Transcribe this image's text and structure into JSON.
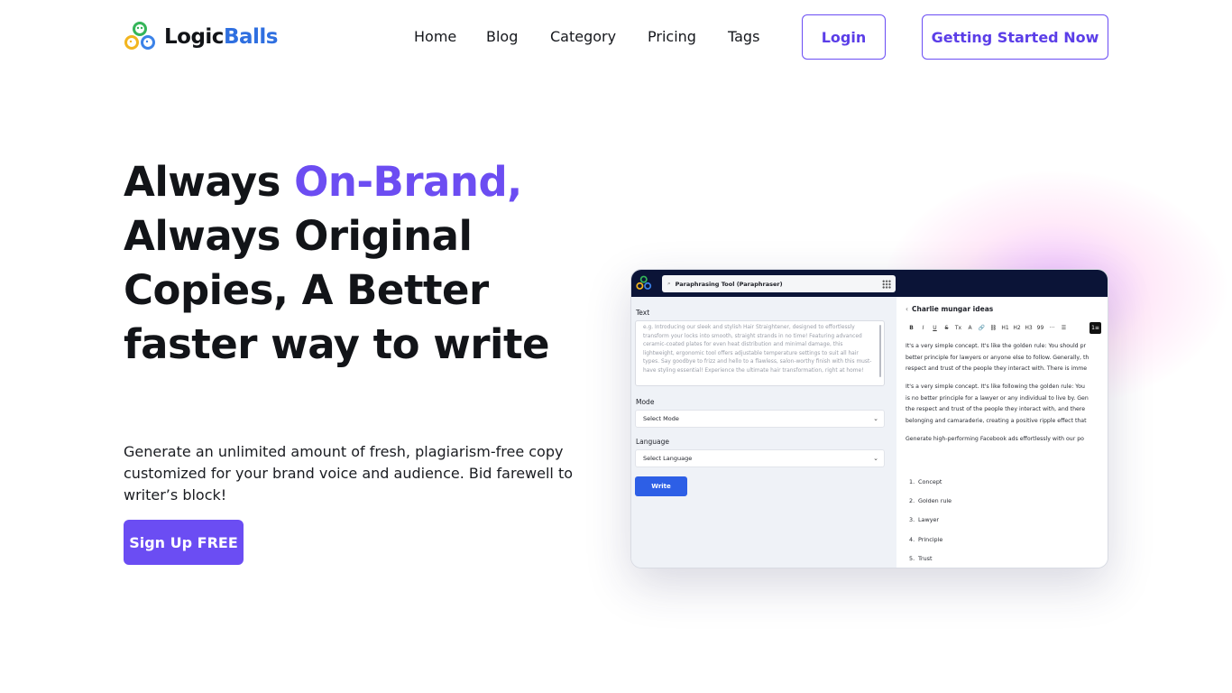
{
  "header": {
    "logo_text_part1": "Logic",
    "logo_text_part2": "Balls",
    "nav": [
      "Home",
      "Blog",
      "Category",
      "Pricing",
      "Tags"
    ],
    "login_label": "Login",
    "start_label": "Getting Started Now"
  },
  "hero": {
    "title_part1": "Always ",
    "title_accent": "On-Brand,",
    "title_part2": "Always Original Copies, A Better faster way to write",
    "subtitle": "Generate an unlimited amount of fresh, plagiarism-free copy customized for your brand voice and audience. Bid farewell to writer’s block!",
    "signup_label": "Sign Up FREE"
  },
  "mockup": {
    "search_text": "Paraphrasing Tool (Paraphraser)",
    "text_label": "Text",
    "text_placeholder": "e.g. Introducing our sleek and stylish Hair Straightener, designed to effortlessly transform your locks into smooth, straight strands in no time! Featuring advanced ceramic-coated plates for even heat distribution and minimal damage, this lightweight, ergonomic tool offers adjustable temperature settings to suit all hair types. Say goodbye to frizz and hello to a flawless, salon-worthy finish with this must-have styling essential! Experience the ultimate hair transformation, right at home!",
    "mode_label": "Mode",
    "mode_value": "Select Mode",
    "language_label": "Language",
    "language_value": "Select Language",
    "write_label": "Write",
    "doc_title": "Charlie mungar ideas",
    "toolbar": [
      "B",
      "I",
      "U",
      "S",
      "Tx",
      "A",
      "🔗",
      "⛓",
      "H1",
      "H2",
      "H3",
      "99",
      "···",
      "☰"
    ],
    "para1": [
      "It's a very simple concept. It's like the golden rule: You should pr",
      "better principle for lawyers or anyone else to follow. Generally, th",
      "respect and trust of the people they interact with. There is imme"
    ],
    "para2": [
      "It's a very simple concept. It's like following the golden rule: You",
      "is no better principle for a lawyer or any individual to live by. Gen",
      "the respect and trust of the people they interact with, and there",
      "belonging and camaraderie, creating a positive ripple effect that"
    ],
    "para3": "Generate high-performing Facebook ads effortlessly with our po",
    "list": [
      "Concept",
      "Golden rule",
      "Lawyer",
      "Principle",
      "Trust"
    ]
  },
  "colors": {
    "accent": "#6b4df3",
    "brand_blue": "#2f6fe0",
    "mock_header": "#0b1437",
    "write_button": "#2d5fe6"
  }
}
